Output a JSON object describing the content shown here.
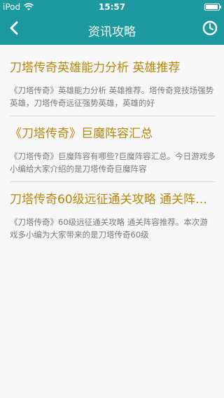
{
  "status_bar": {
    "carrier": "iPod",
    "time": "15:57"
  },
  "nav": {
    "title": "资讯攻略",
    "back_icon": "chevron-left-icon",
    "history_icon": "clock-icon"
  },
  "colors": {
    "header": "#1c9aa0",
    "title_text": "#b8870b",
    "summary_text": "#7a7a7a",
    "background": "#f7f7f7"
  },
  "articles": [
    {
      "title": "刀塔传奇英雄能力分析 英雄推荐",
      "summary": "《刀塔传奇》英雄能力分析 英雄推荐。塔传奇竞技场强势英雄，刀塔传奇远征强势英雄，英雄的好"
    },
    {
      "title": "《刀塔传奇》巨魔阵容汇总",
      "summary": "《刀塔传奇》巨魔阵容有哪些?巨魔阵容汇总。今日游戏多小编给大家介绍的是刀塔传奇巨魔阵容"
    },
    {
      "title": "刀塔传奇60级远征通关攻略 通关阵容推荐",
      "summary": "《刀塔传奇》60级远征通关攻略 通关阵容推荐。本次游戏多小编为大家带来的是刀塔传奇60级"
    }
  ]
}
